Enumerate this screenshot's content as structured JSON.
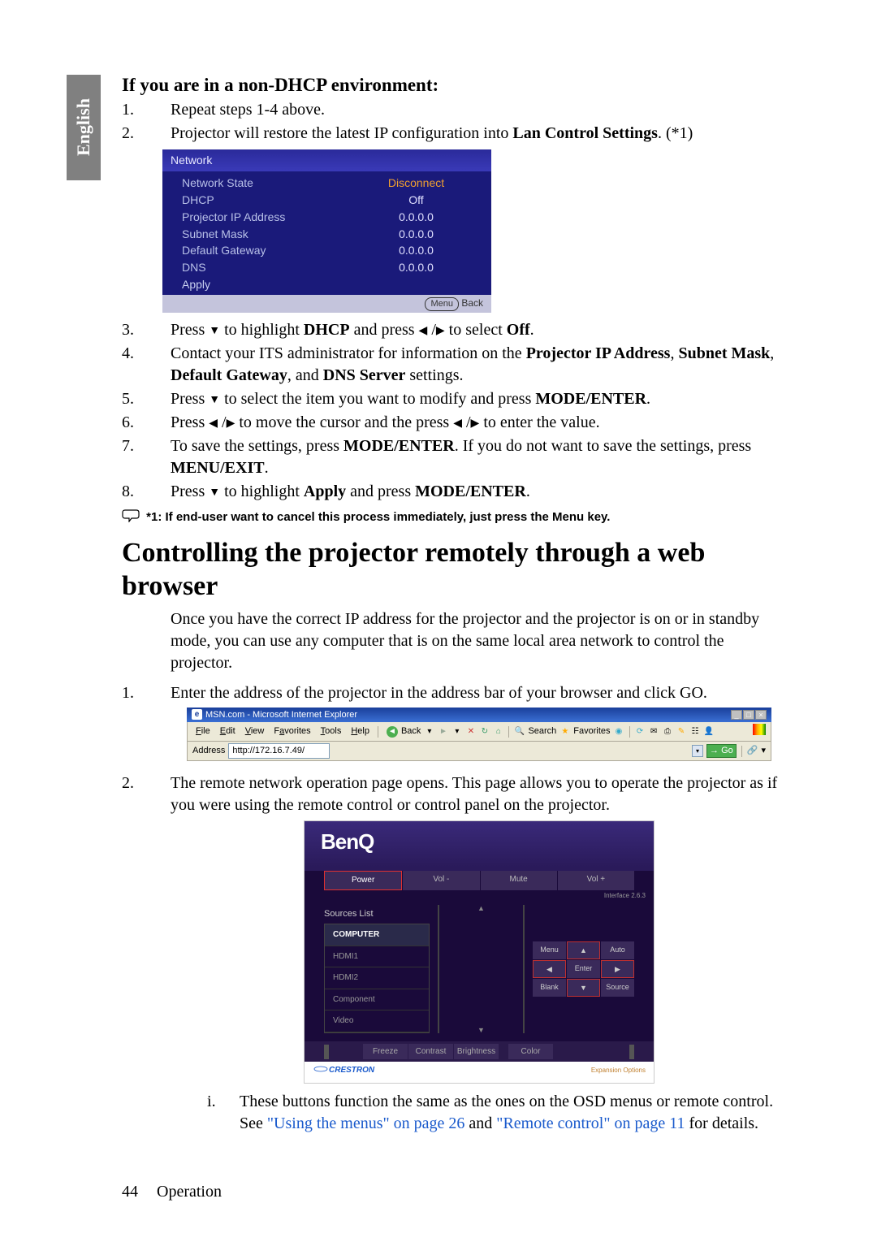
{
  "side_tab": "English",
  "heading_sub": "If you are in a non-DHCP environment:",
  "steps_a": {
    "s1": "Repeat steps 1-4 above.",
    "s2_a": "Projector will restore the latest IP configuration into ",
    "s2_b": "Lan Control Settings",
    "s2_c": ". (*1)"
  },
  "network": {
    "title": "Network",
    "rows": {
      "state_label": "Network State",
      "state_val": "Disconnect",
      "dhcp_label": "DHCP",
      "dhcp_val": "Off",
      "ip_label": "Projector IP Address",
      "ip_val": "0.0.0.0",
      "subnet_label": "Subnet Mask",
      "subnet_val": "0.0.0.0",
      "gw_label": "Default Gateway",
      "gw_val": "0.0.0.0",
      "dns_label": "DNS",
      "dns_val": "0.0.0.0"
    },
    "apply": "Apply",
    "menu_btn": "Menu",
    "back": "Back"
  },
  "steps_b": {
    "s3_a": "Press ",
    "s3_b": " to highlight ",
    "s3_c": "DHCP",
    "s3_d": " and press ",
    "s3_e": " to select ",
    "s3_f": "Off",
    "s3_g": ".",
    "s4_a": "Contact your ITS administrator for information on the ",
    "s4_b": "Projector IP Address",
    "s4_c": ", ",
    "s4_d": "Subnet Mask",
    "s4_e": ", ",
    "s4_f": "Default Gateway",
    "s4_g": ", and ",
    "s4_h": "DNS Server",
    "s4_i": " settings.",
    "s5_a": "Press ",
    "s5_b": " to select the item you want to modify and press ",
    "s5_c": "MODE/ENTER",
    "s5_d": ".",
    "s6_a": "Press ",
    "s6_b": " to move the cursor and the press ",
    "s6_c": " to enter the value.",
    "s7_a": "To save the settings, press ",
    "s7_b": "MODE/ENTER",
    "s7_c": ". If you do not want to save the settings, press ",
    "s7_d": "MENU/EXIT",
    "s7_e": ".",
    "s8_a": "Press ",
    "s8_b": " to highlight ",
    "s8_c": "Apply",
    "s8_d": " and press ",
    "s8_e": "MODE/ENTER",
    "s8_f": "."
  },
  "note": "*1: If end-user want to cancel this process immediately, just press the Menu key.",
  "heading_big": "Controlling the projector remotely through a web browser",
  "para1": "Once you have the correct IP address for the projector and the projector is on or in standby mode, you can use any computer that is on the same local area network to control the projector.",
  "steps_c": {
    "s1": "Enter the address of the projector in the address bar of your browser and click GO.",
    "s2": "The remote network operation page opens. This page allows you to operate the projector as if you were using the remote control or control panel on the projector."
  },
  "ie": {
    "title": "MSN.com - Microsoft Internet Explorer",
    "menu": {
      "file": "File",
      "edit": "Edit",
      "view": "View",
      "favorites": "Favorites",
      "tools": "Tools",
      "help": "Help"
    },
    "back": "Back",
    "search": "Search",
    "fav": "Favorites",
    "addr_label": "Address",
    "addr_value": "http://172.16.7.49/",
    "go": "Go"
  },
  "rc": {
    "logo": "BenQ",
    "power": "Power",
    "volm": "Vol -",
    "mute": "Mute",
    "volp": "Vol +",
    "iface": "Interface 2.6.3",
    "sources_hdr": "Sources List",
    "sources": {
      "computer": "COMPUTER",
      "hdmi1": "HDMI1",
      "hdmi2": "HDMI2",
      "component": "Component",
      "video": "Video"
    },
    "menu": "Menu",
    "auto": "Auto",
    "enter": "Enter",
    "blank": "Blank",
    "source": "Source",
    "freeze": "Freeze",
    "contrast": "Contrast",
    "brightness": "Brightness",
    "color": "Color",
    "crestron": "CRESTRON",
    "expansion": "Expansion Options"
  },
  "roman": {
    "i_a": "These buttons function the same as the ones on the OSD menus or remote control. See ",
    "i_link1": "\"Using the menus\" on page 26",
    "i_b": " and ",
    "i_link2": "\"Remote control\" on page 11",
    "i_c": " for details."
  },
  "footer": {
    "page": "44",
    "section": "Operation"
  }
}
